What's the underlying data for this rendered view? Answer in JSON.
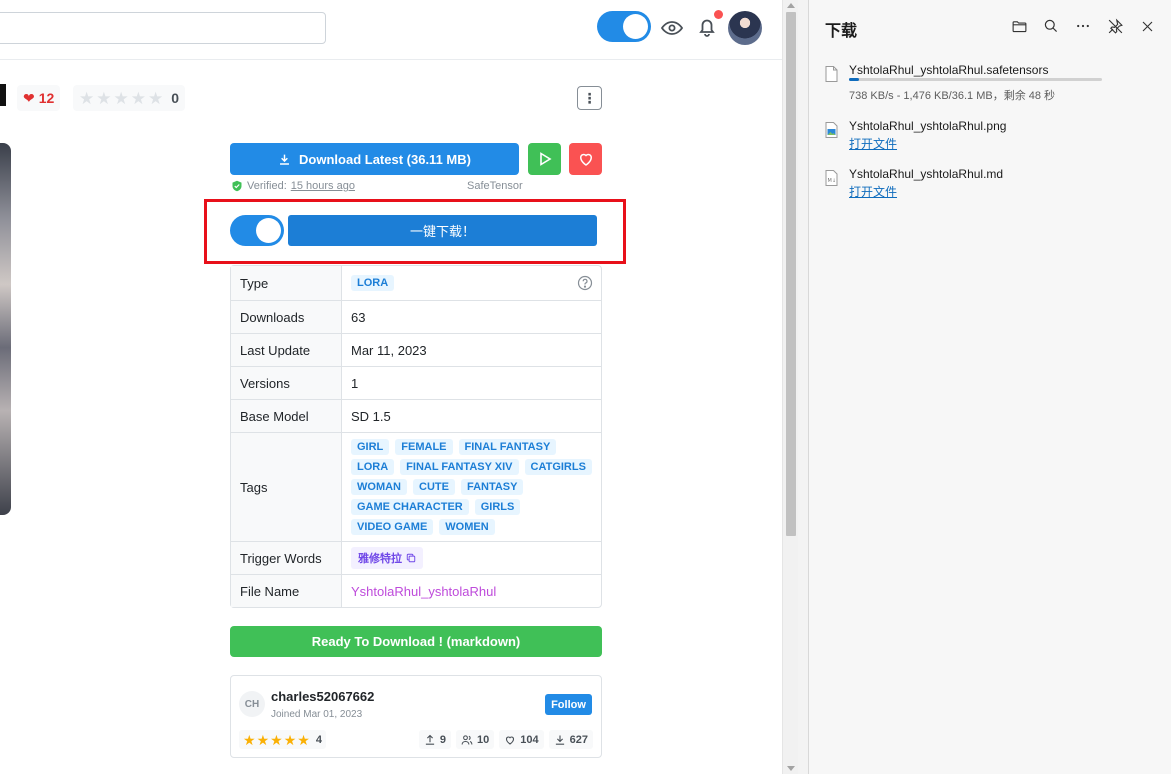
{
  "header": {
    "nsfw_toggle_on": true,
    "notification_dot": true
  },
  "model": {
    "likes": "12",
    "rating_count": "0",
    "rating_stars": 0
  },
  "actions": {
    "download_label": "Download Latest (36.11 MB)",
    "verified_prefix": "Verified:",
    "verified_time": "15 hours ago",
    "file_format": "SafeTensor",
    "onekey_label": "一键下载！",
    "ready_label": "Ready To Download ! (markdown)"
  },
  "details": {
    "type_key": "Type",
    "type_value": "LORA",
    "downloads_key": "Downloads",
    "downloads_value": "63",
    "last_update_key": "Last Update",
    "last_update_value": "Mar 11, 2023",
    "versions_key": "Versions",
    "versions_value": "1",
    "base_model_key": "Base Model",
    "base_model_value": "SD 1.5",
    "tags_key": "Tags",
    "tags": [
      "GIRL",
      "FEMALE",
      "FINAL FANTASY",
      "LORA",
      "FINAL FANTASY XIV",
      "CATGIRLS",
      "WOMAN",
      "CUTE",
      "FANTASY",
      "GAME CHARACTER",
      "GIRLS",
      "VIDEO GAME",
      "WOMEN"
    ],
    "trigger_key": "Trigger Words",
    "trigger_value": "雅修特拉",
    "file_name_key": "File Name",
    "file_name_value": "YshtolaRhul_yshtolaRhul"
  },
  "creator": {
    "initials": "CH",
    "name": "charles52067662",
    "joined": "Joined Mar 01, 2023",
    "follow_label": "Follow",
    "rating_stars": 5,
    "rating_count": "4",
    "uploads": "9",
    "followers": "10",
    "favorites": "104",
    "downloads": "627"
  },
  "downloads_panel": {
    "title": "下载",
    "items": [
      {
        "name": "YshtolaRhul_yshtolaRhul.safetensors",
        "status": "738 KB/s - 1,476 KB/36.1 MB，剩余 48 秒",
        "progress": 0.04
      },
      {
        "name": "YshtolaRhul_yshtolaRhul.png",
        "link": "打开文件"
      },
      {
        "name": "YshtolaRhul_yshtolaRhul.md",
        "link": "打开文件"
      }
    ]
  },
  "colors": {
    "primary": "#228be6",
    "success": "#40c057",
    "danger": "#fa5252",
    "highlight": "#e8101a",
    "edge_link": "#0f6cbd"
  }
}
